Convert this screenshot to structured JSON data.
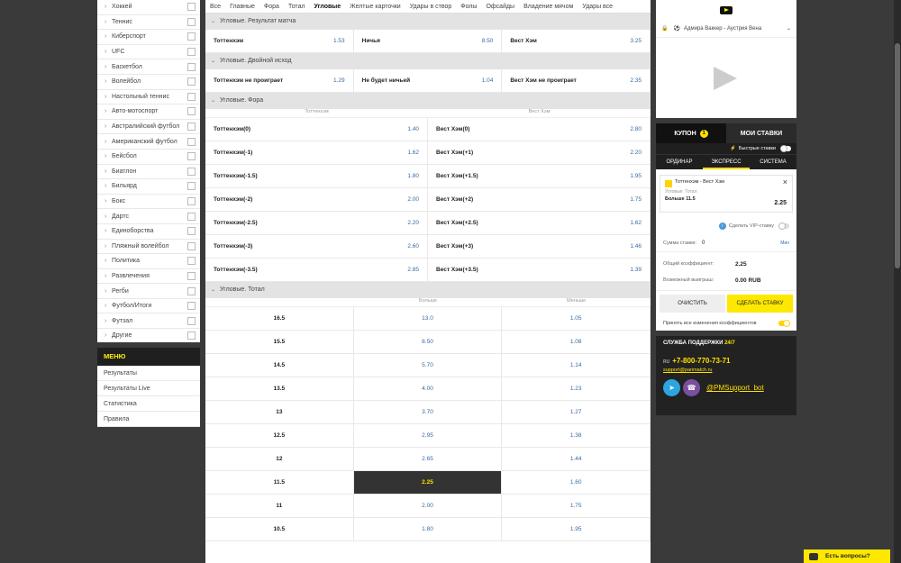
{
  "sports": [
    "Хоккей",
    "Теннис",
    "Киберспорт",
    "UFC",
    "Баскетбол",
    "Волейбол",
    "Настольный теннис",
    "Авто-мотоспорт",
    "Австралийский футбол",
    "Американский футбол",
    "Бейсбол",
    "Биатлон",
    "Бильярд",
    "Бокс",
    "Дартс",
    "Единоборства",
    "Пляжный волейбол",
    "Политика",
    "Развлечения",
    "Регби",
    "Футбол/Итоги",
    "Футзал",
    "Другие"
  ],
  "menu": {
    "title": "МЕНЮ",
    "items": [
      "Результаты",
      "Результаты Live",
      "Статистика",
      "Правила"
    ]
  },
  "tabs": [
    "Все",
    "Главные",
    "Фора",
    "Тотал",
    "Угловые",
    "Желтые карточки",
    "Удары в створ",
    "Фолы",
    "Офсайды",
    "Владение мячом",
    "Удары в створ"
  ],
  "tabs_fix": [
    "Все",
    "Главные",
    "Фора",
    "Тотал",
    "Угловые",
    "Желтые карточки",
    "Удары в створ",
    "Фолы",
    "Офсайды",
    "Владение мячом",
    "Удары все"
  ],
  "active_tab": "Угловые",
  "sec_result": {
    "title": "Угловые. Результат матча",
    "cells": [
      {
        "n": "Тоттенхэм",
        "o": "1.53"
      },
      {
        "n": "Ничья",
        "o": "8.50"
      },
      {
        "n": "Вест Хэм",
        "o": "3.25"
      }
    ]
  },
  "sec_double": {
    "title": "Угловые. Двойной исход",
    "cells": [
      {
        "n": "Тоттенхэм не проиграет",
        "o": "1.29"
      },
      {
        "n": "Не будет ничьей",
        "o": "1.04"
      },
      {
        "n": "Вест Хэм не проиграет",
        "o": "2.35"
      }
    ]
  },
  "sec_handicap": {
    "title": "Угловые. Фора",
    "h1": "Тоттенхэм",
    "h2": "Вест Хэм",
    "rows": [
      [
        "Тоттенхэм(0)",
        "1.40",
        "Вест Хэм(0)",
        "2.80"
      ],
      [
        "Тоттенхэм(-1)",
        "1.62",
        "Вест Хэм(+1)",
        "2.20"
      ],
      [
        "Тоттенхэм(-1.5)",
        "1.80",
        "Вест Хэм(+1.5)",
        "1.95"
      ],
      [
        "Тоттенхэм(-2)",
        "2.00",
        "Вест Хэм(+2)",
        "1.75"
      ],
      [
        "Тоттенхэм(-2.5)",
        "2.20",
        "Вест Хэм(+2.5)",
        "1.62"
      ],
      [
        "Тоттенхэм(-3)",
        "2.60",
        "Вест Хэм(+3)",
        "1.46"
      ],
      [
        "Тоттенхэм(-3.5)",
        "2.85",
        "Вест Хэм(+3.5)",
        "1.39"
      ]
    ]
  },
  "sec_total": {
    "title": "Угловые. Тотал",
    "h1": "Больше",
    "h2": "Меньше",
    "rows": [
      [
        "16.5",
        "13.0",
        "1.05"
      ],
      [
        "15.5",
        "8.50",
        "1.08"
      ],
      [
        "14.5",
        "5.70",
        "1.14"
      ],
      [
        "13.5",
        "4.00",
        "1.23"
      ],
      [
        "13",
        "3.70",
        "1.27"
      ],
      [
        "12.5",
        "2.95",
        "1.38"
      ],
      [
        "12",
        "2.65",
        "1.44"
      ],
      [
        "11.5",
        "2.25",
        "1.60"
      ],
      [
        "11",
        "2.00",
        "1.75"
      ],
      [
        "10.5",
        "1.80",
        "1.95"
      ]
    ],
    "selected_line": "11.5"
  },
  "video": {
    "match": "Адмира Ваккер - Аустрия Вена"
  },
  "coupon": {
    "tab1": "КУПОН",
    "count": "1",
    "tab2": "МОИ СТАВКИ",
    "quick": "Быстрые ставки",
    "types": [
      "ОРДИНАР",
      "ЭКСПРЕСС",
      "СИСТЕМА"
    ],
    "bet_title": "Тоттенхэм - Вест Хэм",
    "bet_market": "Угловые: Тотал",
    "bet_sel": "Больше 11.5",
    "bet_odd": "2.25",
    "vip": "Сделать VIP-ставку",
    "stake_label": "Сумма ставки:",
    "stake_value": "0",
    "min": "Мин",
    "total_label": "Общий коэффициент:",
    "total_value": "2.25",
    "win_label": "Возможный выигрыш:",
    "win_value": "0.00 RUB",
    "clear": "ОЧИСТИТЬ",
    "place": "СДЕЛАТЬ СТАВКУ",
    "accept": "Принять все изменения коэффициентов"
  },
  "support": {
    "title": "СЛУЖБА ПОДДЕРЖКИ",
    "hours": "24/7",
    "cc": "RU",
    "phone": "+7-800-770-73-71",
    "email": "support@parimatch.ru",
    "bot": "@PMSupport_bot"
  },
  "chat": "Есть вопросы?"
}
